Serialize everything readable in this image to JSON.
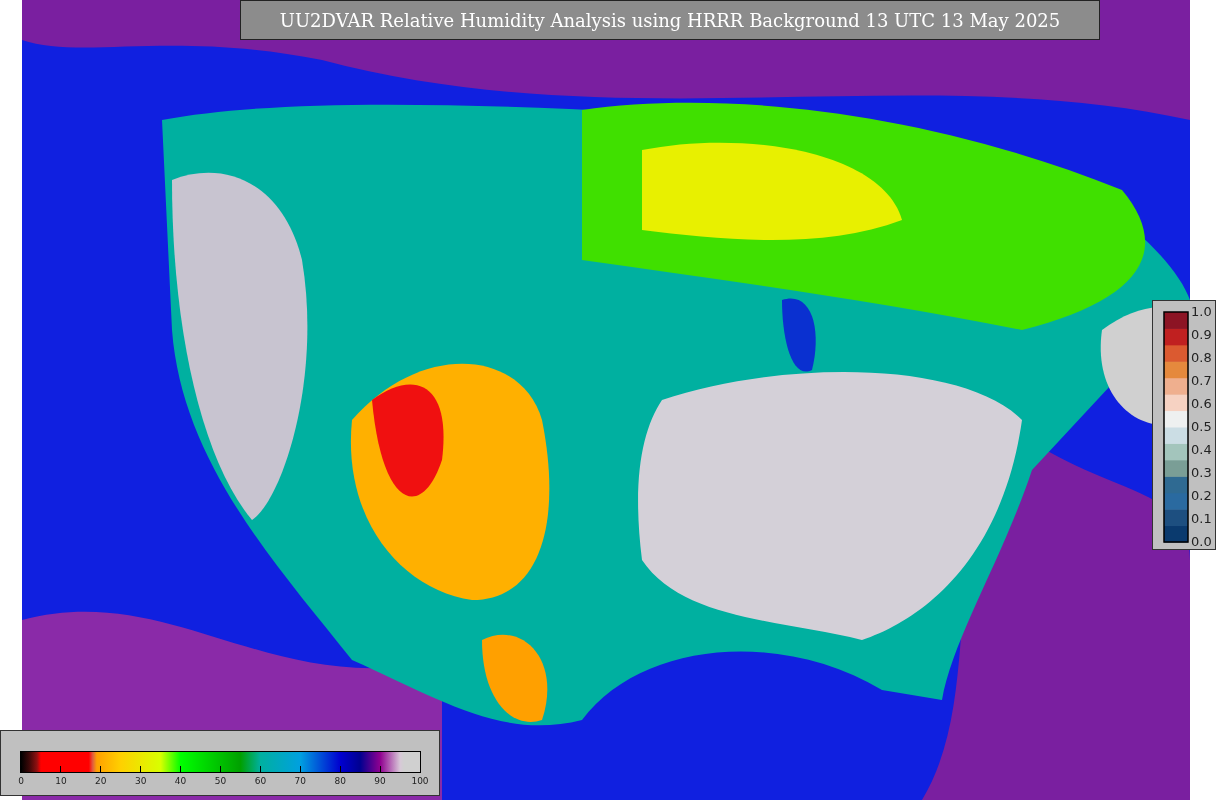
{
  "title": "UU2DVAR Relative Humidity Analysis using HRRR Background 13 UTC 13 May 2025",
  "humidity_legend": {
    "ticks": [
      "0",
      "10",
      "20",
      "30",
      "40",
      "50",
      "60",
      "70",
      "80",
      "90",
      "100"
    ]
  },
  "ratio_legend": {
    "ticks": [
      "1.0",
      "0.9",
      "0.8",
      "0.7",
      "0.6",
      "0.5",
      "0.4",
      "0.3",
      "0.2",
      "0.1",
      "0.0"
    ]
  }
}
